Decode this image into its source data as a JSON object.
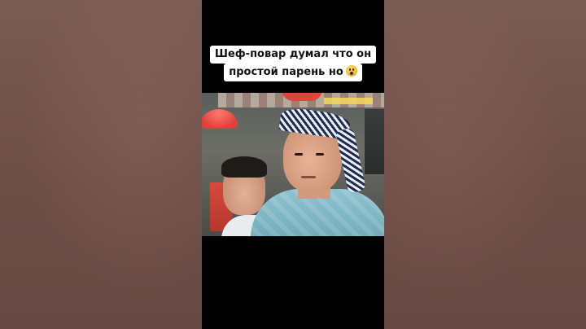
{
  "caption": {
    "line1": "Шеф-повар думал что он",
    "line2": "простой парень но",
    "emoji": "screaming-face-emoji"
  }
}
